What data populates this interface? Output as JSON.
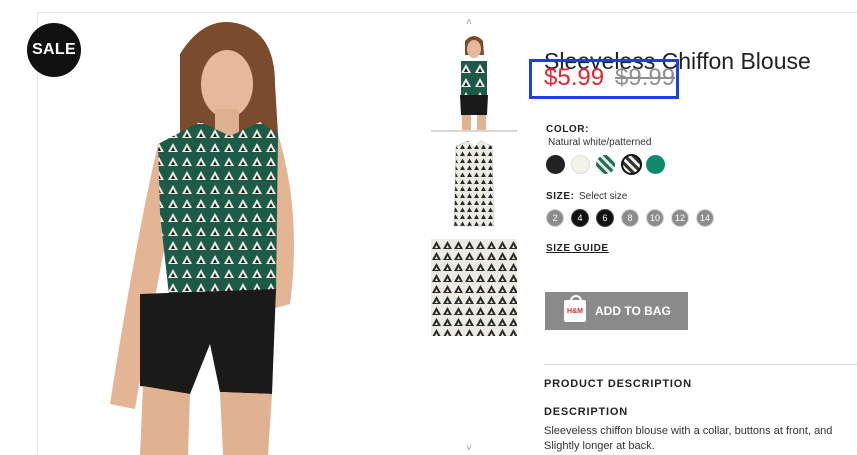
{
  "badge": {
    "sale": "SALE"
  },
  "product": {
    "title": "Sleeveless Chiffon Blouse",
    "price_current": "$5.99",
    "price_old": "$9.99",
    "color_label": "COLOR:",
    "color_name": "Natural white/patterned",
    "swatches": [
      "black",
      "natural white",
      "green patterned",
      "black/white patterned",
      "green"
    ],
    "size_label": "SIZE:",
    "size_hint": "Select size",
    "sizes": [
      "2",
      "4",
      "6",
      "8",
      "10",
      "12",
      "14"
    ],
    "size_guide": "SIZE GUIDE",
    "add_to_bag": "ADD TO BAG",
    "bag_logo": "H&M",
    "description_heading": "PRODUCT DESCRIPTION",
    "description_sub": "DESCRIPTION",
    "description_line1": "Sleeveless chiffon blouse with a collar, buttons at front, and",
    "description_line2": "Slightly longer at back."
  },
  "thumbs": {
    "up_arrow": "˄",
    "down_arrow": "˅"
  },
  "colors": {
    "price_highlight": "#1f3ee0",
    "sale_price": "#e3262e",
    "button": "#8a8a8a"
  }
}
